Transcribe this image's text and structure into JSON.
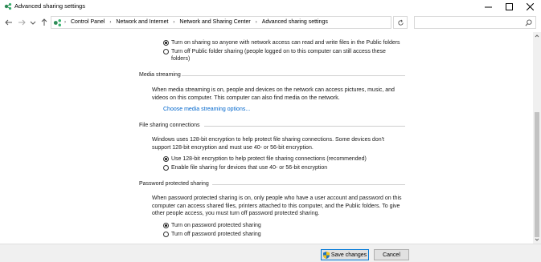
{
  "window": {
    "title": "Advanced sharing settings"
  },
  "nav": {
    "breadcrumbs": [
      "Control Panel",
      "Network and Internet",
      "Network and Sharing Center",
      "Advanced sharing settings"
    ],
    "search_placeholder": ""
  },
  "public_folder": {
    "option_on": "Turn on sharing so anyone with network access can read and write files in the Public folders",
    "option_off_line1": "Turn off Public folder sharing (people logged on to this computer can still access these",
    "option_off_line2": "folders)",
    "selected": "on"
  },
  "media_streaming": {
    "heading": "Media streaming",
    "desc_line1": "When media streaming is on, people and devices on the network can access pictures, music, and",
    "desc_line2": "videos on this computer. This computer can also find media on the network.",
    "link": "Choose media streaming options..."
  },
  "file_sharing": {
    "heading": "File sharing connections",
    "desc_line1": "Windows uses 128-bit encryption to help protect file sharing connections. Some devices don't",
    "desc_line2": "support 128-bit encryption and must use 40- or 56-bit encryption.",
    "option_128": "Use 128-bit encryption to help protect file sharing connections (recommended)",
    "option_40": "Enable file sharing for devices that use 40- or 56-bit encryption",
    "selected": "128"
  },
  "password_sharing": {
    "heading": "Password protected sharing",
    "desc_line1": "When password protected sharing is on, only people who have a user account and password on this",
    "desc_line2": "computer can access shared files, printers attached to this computer, and the Public folders. To give",
    "desc_line3": "other people access, you must turn off password protected sharing.",
    "option_on": "Turn on password protected sharing",
    "option_off": "Turn off password protected sharing",
    "selected": "on"
  },
  "footer": {
    "save_label": "Save changes",
    "cancel_label": "Cancel"
  },
  "colors": {
    "link": "#0066cc",
    "accent": "#0078d7"
  }
}
